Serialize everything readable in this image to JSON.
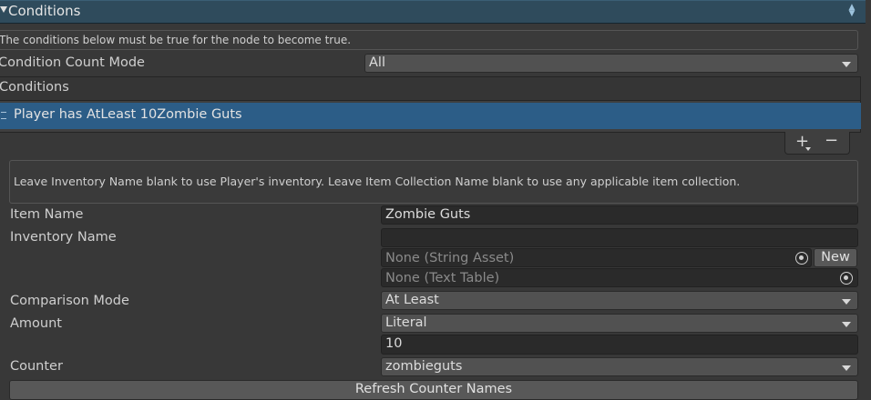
{
  "header": {
    "title": "Conditions"
  },
  "help_text": "The conditions below must be true for the node to become true.",
  "condition_count_mode": {
    "label": "Condition Count Mode",
    "value": "All"
  },
  "conditions_list": {
    "header": "Conditions",
    "items": [
      {
        "label": "Player has AtLeast 10Zombie Guts",
        "selected": true
      }
    ],
    "add_icon": "plus-icon",
    "remove_icon": "minus-icon"
  },
  "item_help": "Leave Inventory Name blank to use Player's inventory. Leave Item Collection Name blank to use any applicable item collection.",
  "item_name": {
    "label": "Item Name",
    "value": "Zombie Guts"
  },
  "inventory_name": {
    "label": "Inventory Name",
    "value": "",
    "string_asset_placeholder": "None (String Asset)",
    "new_button": "New",
    "text_table_placeholder": "None (Text Table)"
  },
  "comparison_mode": {
    "label": "Comparison Mode",
    "value": "At Least"
  },
  "amount": {
    "label": "Amount",
    "mode": "Literal",
    "value": "10"
  },
  "counter": {
    "label": "Counter",
    "value": "zombieguts"
  },
  "refresh_button": "Refresh Counter Names",
  "colors": {
    "background": "#383838",
    "header": "#2f4b5c",
    "selected_row": "#2c5d87",
    "field": "#2a2a2a",
    "dropdown": "#515151"
  }
}
